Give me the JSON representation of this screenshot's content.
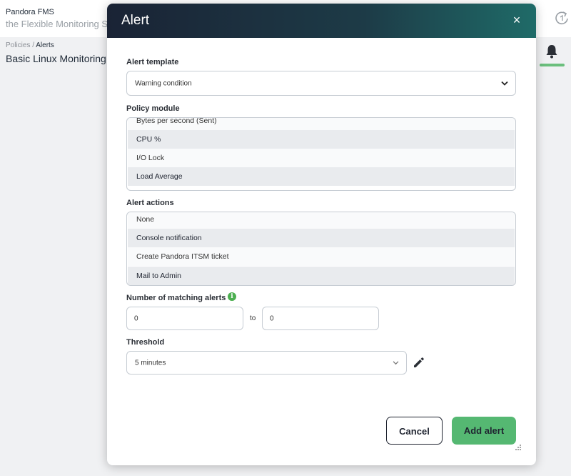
{
  "app": {
    "brand_title": "Pandora FMS",
    "brand_subtitle": "the Flexible Monitoring S",
    "breadcrumb_parent": "Policies / ",
    "breadcrumb_current": "Alerts",
    "page_title": "Basic Linux Monitoring"
  },
  "modal": {
    "title": "Alert",
    "close_label": "×",
    "alert_template": {
      "label": "Alert template",
      "value": "Warning condition"
    },
    "policy_module": {
      "label": "Policy module",
      "items": [
        {
          "label": "Bytes per second (Sent)",
          "selected": false
        },
        {
          "label": "CPU %",
          "selected": true
        },
        {
          "label": "I/O Lock",
          "selected": false
        },
        {
          "label": "Load Average",
          "selected": true
        }
      ]
    },
    "alert_actions": {
      "label": "Alert actions",
      "items": [
        {
          "label": "None",
          "selected": false
        },
        {
          "label": "Console notification",
          "selected": true
        },
        {
          "label": "Create Pandora ITSM ticket",
          "selected": false
        },
        {
          "label": "Mail to Admin",
          "selected": true
        }
      ]
    },
    "matching_alerts": {
      "label": "Number of matching alerts",
      "info_icon": "i",
      "from_value": "0",
      "to_label": "to",
      "to_value": "0"
    },
    "threshold": {
      "label": "Threshold",
      "value": "5 minutes"
    },
    "cancel_label": "Cancel",
    "add_label": "Add alert"
  },
  "colors": {
    "accent_green": "#55b872",
    "header_dark": "#1a2335",
    "header_teal": "#1f6b68"
  }
}
